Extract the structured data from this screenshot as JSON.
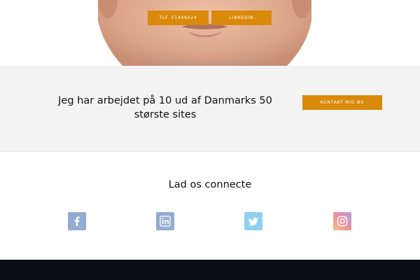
{
  "hero": {
    "phone_label": "TLF. 51446024",
    "linkedin_label": "LINKEDIN"
  },
  "cta": {
    "text": "Jeg har arbejdet på 10 ud af Danmarks 50 største sites",
    "button_label": "KONTAKT MIG NU"
  },
  "connect": {
    "title": "Lad os connecte",
    "icons": [
      "facebook-icon",
      "linkedin-icon",
      "twitter-icon",
      "instagram-icon"
    ]
  },
  "colors": {
    "accent": "#d98a0a",
    "cta_background": "#f3f3f3",
    "footer_background": "#0d0e14",
    "social_blue": "#93acd1",
    "twitter_blue": "#8fd0ef"
  }
}
